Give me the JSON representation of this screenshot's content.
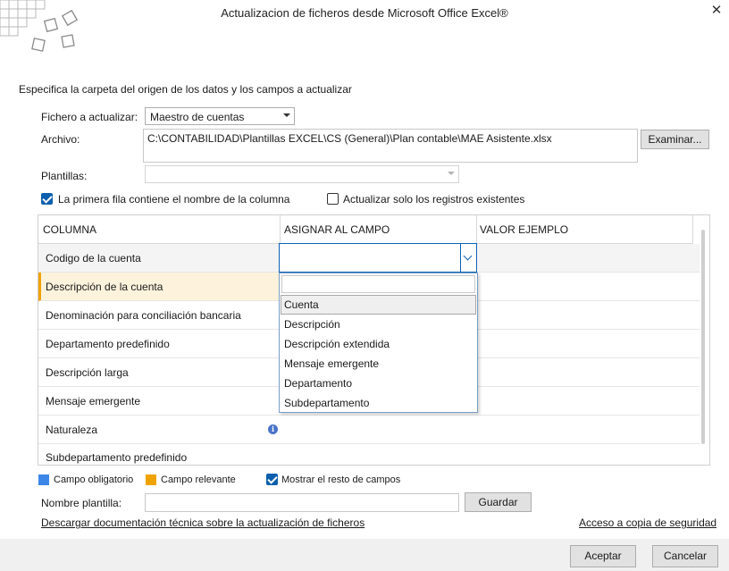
{
  "window": {
    "title": "Actualizacion de ficheros desde Microsoft Office Excel®",
    "close_glyph": "✕"
  },
  "instructions": "Especifica la carpeta del origen de los datos y los campos a actualizar",
  "form": {
    "fichero_label": "Fichero a actualizar:",
    "fichero_value": "Maestro de cuentas",
    "archivo_label": "Archivo:",
    "archivo_value": "C:\\CONTABILIDAD\\Plantillas EXCEL\\CS (General)\\Plan contable\\MAE Asistente.xlsx",
    "examinar_label": "Examinar...",
    "plantillas_label": "Plantillas:",
    "plantillas_value": "",
    "primera_fila_label": "La primera fila contiene el nombre de la columna",
    "primera_fila_checked": true,
    "actualizar_solo_label": "Actualizar solo los registros existentes",
    "actualizar_solo_checked": false
  },
  "grid": {
    "headers": [
      "COLUMNA",
      "ASIGNAR AL CAMPO",
      "VALOR EJEMPLO"
    ],
    "rows": [
      {
        "columna": "Codigo de la cuenta"
      },
      {
        "columna": "Descripción de la cuenta"
      },
      {
        "columna": "Denominación para conciliación bancaria"
      },
      {
        "columna": "Departamento predefinido"
      },
      {
        "columna": "Descripción larga"
      },
      {
        "columna": "Mensaje emergente"
      },
      {
        "columna": "Naturaleza"
      },
      {
        "columna": "Subdepartamento predefinido"
      }
    ],
    "info_glyph": "i"
  },
  "dropdown": {
    "filter_value": "",
    "options": [
      "Cuenta",
      "Descripción",
      "Descripción extendida",
      "Mensaje emergente",
      "Departamento",
      "Subdepartamento"
    ],
    "hovered_index": 0
  },
  "legend": {
    "obligatorio_label": "Campo obligatorio",
    "obligatorio_color": "#3c86e8",
    "relevante_label": "Campo relevante",
    "relevante_color": "#f0a200",
    "mostrar_label": "Mostrar el resto de campos",
    "mostrar_checked": true
  },
  "plantilla": {
    "label": "Nombre plantilla:",
    "value": "",
    "guardar_label": "Guardar"
  },
  "links": {
    "documentacion": "Descargar documentación técnica sobre la actualización de ficheros",
    "copia": "Acceso a copia de seguridad"
  },
  "footer": {
    "aceptar_label": "Aceptar",
    "cancelar_label": "Cancelar"
  }
}
